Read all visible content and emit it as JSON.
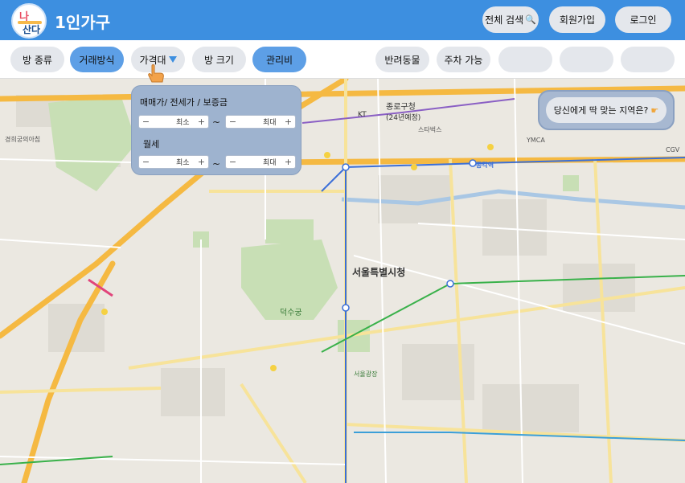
{
  "header": {
    "logo_top": "나",
    "logo_bottom": "산다",
    "title": "1인가구",
    "buttons": {
      "search": "전체 검색",
      "signup": "회원가입",
      "login": "로그인"
    }
  },
  "filters": {
    "room_type": "방 종류",
    "deal_type": "거래방식",
    "price": "가격대",
    "room_size": "방 크기",
    "maintenance": "관리비",
    "pets": "반려동물",
    "parking": "주차 가능"
  },
  "price_popup": {
    "section1_label": "매매가/ 전세가 / 보증금",
    "section2_label": "월세",
    "min_placeholder": "최소",
    "max_placeholder": "최대",
    "tilde": "~",
    "minus": "−",
    "plus": "+"
  },
  "recommend": {
    "label": "당신에게 딱 맞는 지역은?"
  },
  "map": {
    "labels": {
      "city_hall": "서울특별시청",
      "jongno_office": "종로구청",
      "jongno_office_sub": "(24년예정)",
      "deoksugung": "덕수궁",
      "gyeonghuigung": "경희궁의아침",
      "seoul_gwangjang": "서울광장",
      "ymca": "YMCA",
      "cgv": "CGV",
      "kt": "KT",
      "starbucks": "스타벅스",
      "jongno_3": "종각역"
    }
  },
  "colors": {
    "header_bg": "#3d8fe0",
    "active_filter": "#5d9fe6",
    "popup_bg": "#9eb3cf"
  }
}
